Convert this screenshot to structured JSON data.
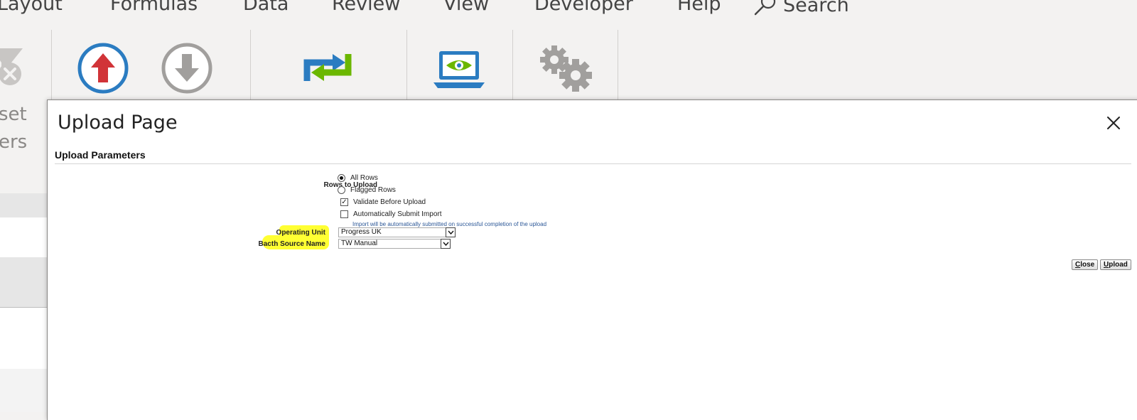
{
  "ribbon_tabs": {
    "layout": "Layout",
    "formulas": "Formulas",
    "data": "Data",
    "review": "Review",
    "view": "View",
    "developer": "Developer",
    "help": "Help",
    "search": "Search"
  },
  "ribbon_partial": {
    "line1": "set",
    "line2": "ers"
  },
  "colors": {
    "upload_icon": "#2b7cc1",
    "upload_arrow": "#d13438",
    "download_icon": "#a19f9d",
    "refresh_blue": "#2b7cc1",
    "refresh_green": "#6bb700",
    "highlight": "#ffff33",
    "hint_text": "#2b5797"
  },
  "dialog": {
    "title": "Upload Page",
    "section_title": "Upload Parameters",
    "rows_to_upload_label": "Rows to Upload",
    "options": {
      "all_rows": "All Rows",
      "flagged_rows": "Flagged Rows",
      "validate_before_upload": "Validate Before Upload",
      "auto_submit_import": "Automatically Submit Import"
    },
    "auto_submit_hint": "Import will be automatically submitted on successful completion of the upload",
    "operating_unit_label": "Operating Unit",
    "operating_unit_value": "Progress UK",
    "batch_source_label": "Bacth Source Name",
    "batch_source_value": "TW Manual",
    "buttons": {
      "close_first": "C",
      "close_rest": "lose",
      "upload_first": "U",
      "upload_rest": "pload"
    }
  }
}
